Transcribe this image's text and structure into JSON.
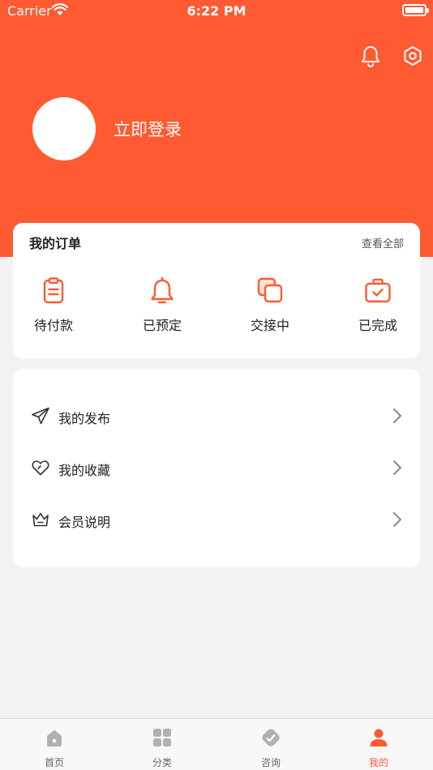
{
  "status_bar": {
    "carrier": "Carrier",
    "time": "6:22 PM"
  },
  "header": {
    "login_label": "立即登录"
  },
  "orders": {
    "title": "我的订单",
    "view_all": "查看全部",
    "items": [
      {
        "label": "待付款",
        "icon": "clipboard-icon"
      },
      {
        "label": "已预定",
        "icon": "bell-icon"
      },
      {
        "label": "交接中",
        "icon": "copy-icon"
      },
      {
        "label": "已完成",
        "icon": "briefcase-check-icon"
      }
    ]
  },
  "menu": {
    "items": [
      {
        "label": "我的发布",
        "icon": "send-icon"
      },
      {
        "label": "我的收藏",
        "icon": "heart-icon"
      },
      {
        "label": "会员说明",
        "icon": "crown-icon"
      }
    ]
  },
  "tabbar": {
    "items": [
      {
        "label": "首页",
        "icon": "home-icon"
      },
      {
        "label": "分类",
        "icon": "grid-icon"
      },
      {
        "label": "咨询",
        "icon": "chat-icon"
      },
      {
        "label": "我的",
        "icon": "user-icon",
        "active": true
      }
    ]
  },
  "colors": {
    "accent": "#ff5a31",
    "background": "#f2f2f2",
    "inactive_tab": "#b0b0b0"
  }
}
